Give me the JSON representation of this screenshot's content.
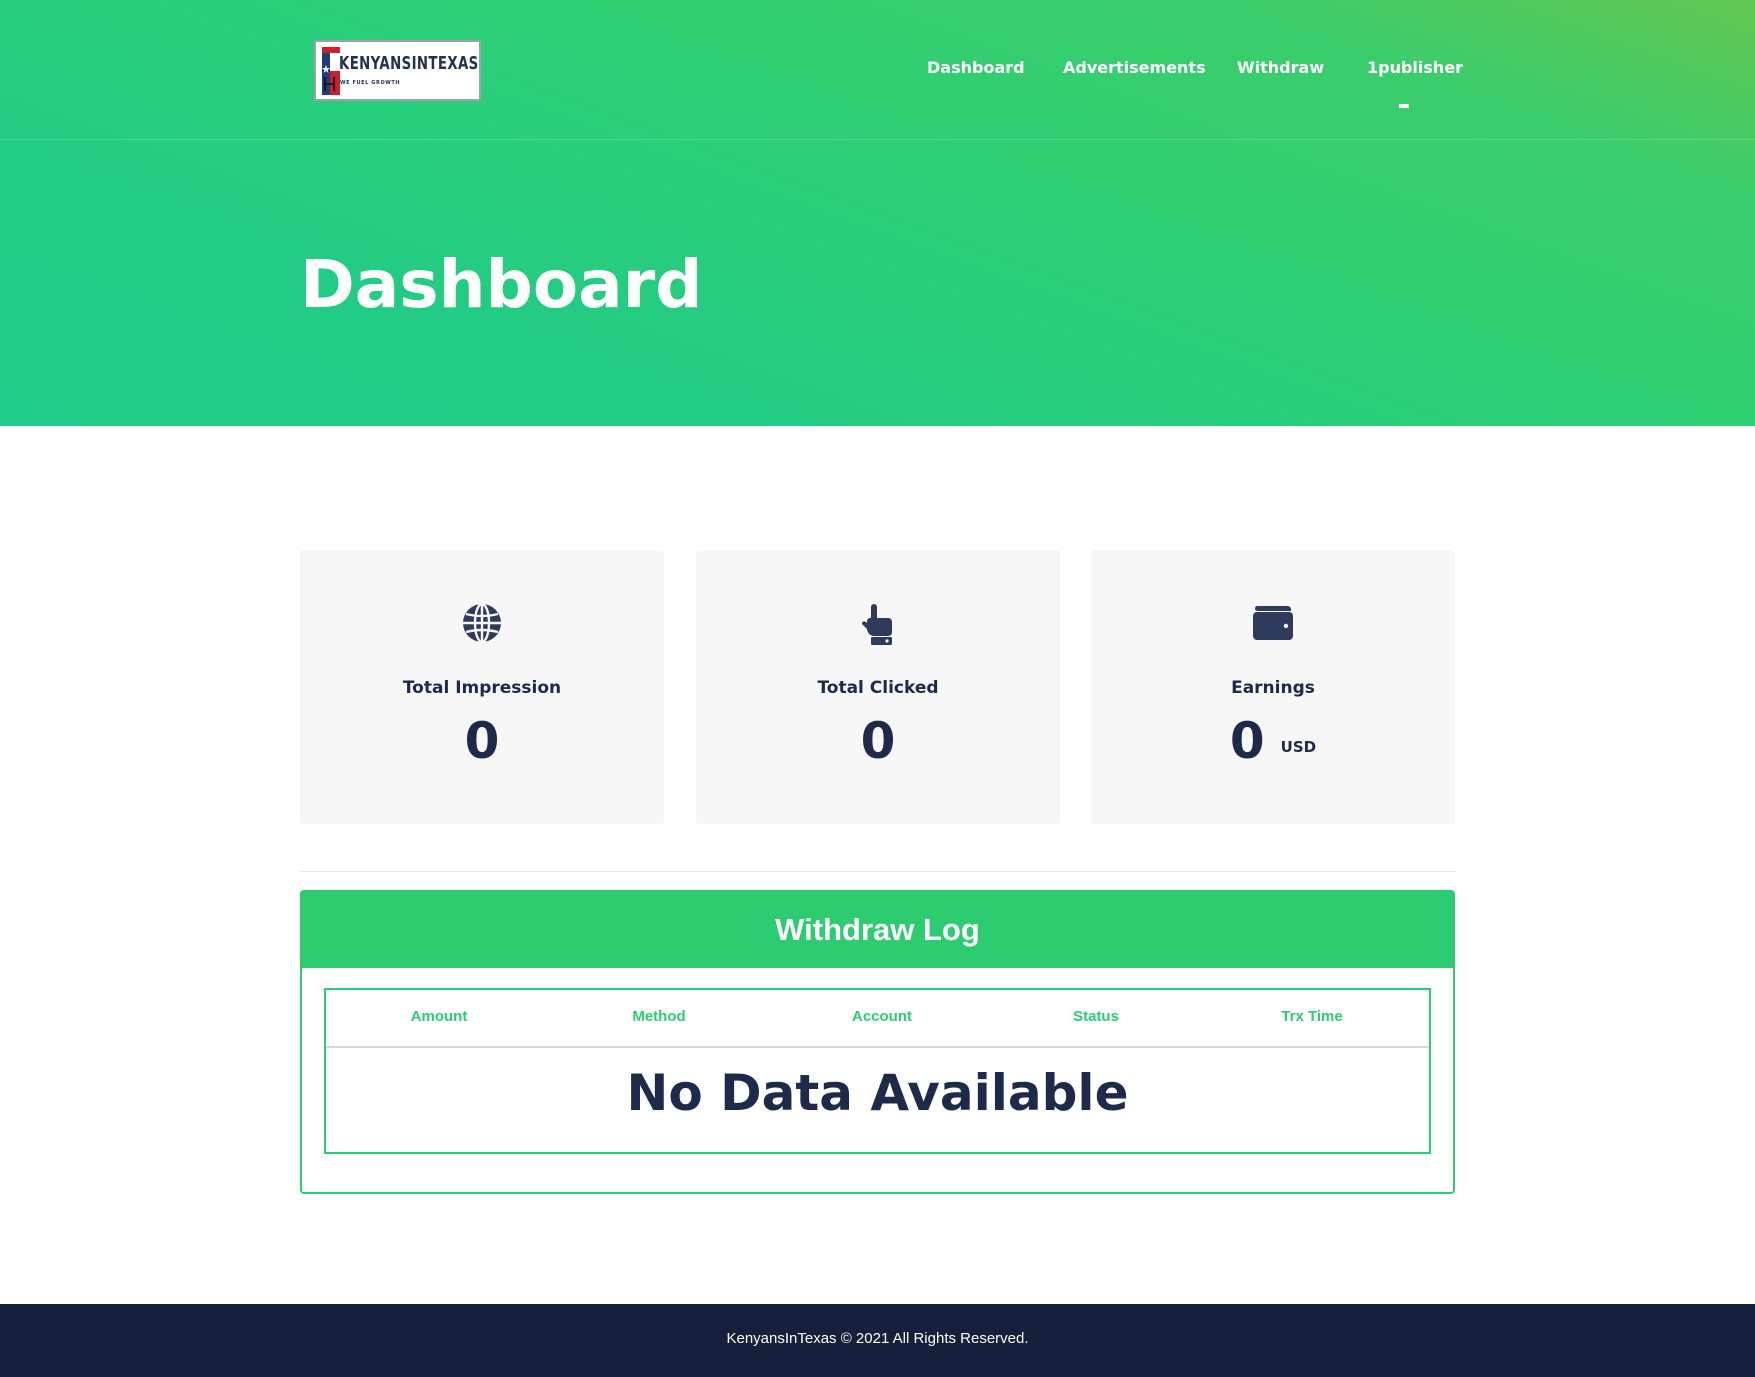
{
  "brand": {
    "name": "KENYANSINTEXAS",
    "tagline": "WE FUEL GROWTH"
  },
  "nav": {
    "items": [
      "Dashboard",
      "Advertisements",
      "Withdraw",
      "1publisher"
    ]
  },
  "hero": {
    "title": "Dashboard"
  },
  "stats": [
    {
      "icon": "globe-icon",
      "label": "Total Impression",
      "value": "0"
    },
    {
      "icon": "pointing-hand-icon",
      "label": "Total Clicked",
      "value": "0"
    },
    {
      "icon": "wallet-icon",
      "label": "Earnings",
      "value": "0",
      "unit": "USD"
    }
  ],
  "withdraw_log": {
    "title": "Withdraw Log",
    "columns": [
      "Amount",
      "Method",
      "Account",
      "Status",
      "Trx Time"
    ],
    "empty_text": "No Data Available"
  },
  "footer": {
    "text": "KenyansInTexas © 2021 All Rights Reserved."
  },
  "colors": {
    "primary": "#2ecc71",
    "hero_start": "#1fcb88",
    "hero_end": "#63c852",
    "dark": "#15203b",
    "text_dark": "#1d2a4a",
    "card_bg": "#f7f7f7"
  }
}
